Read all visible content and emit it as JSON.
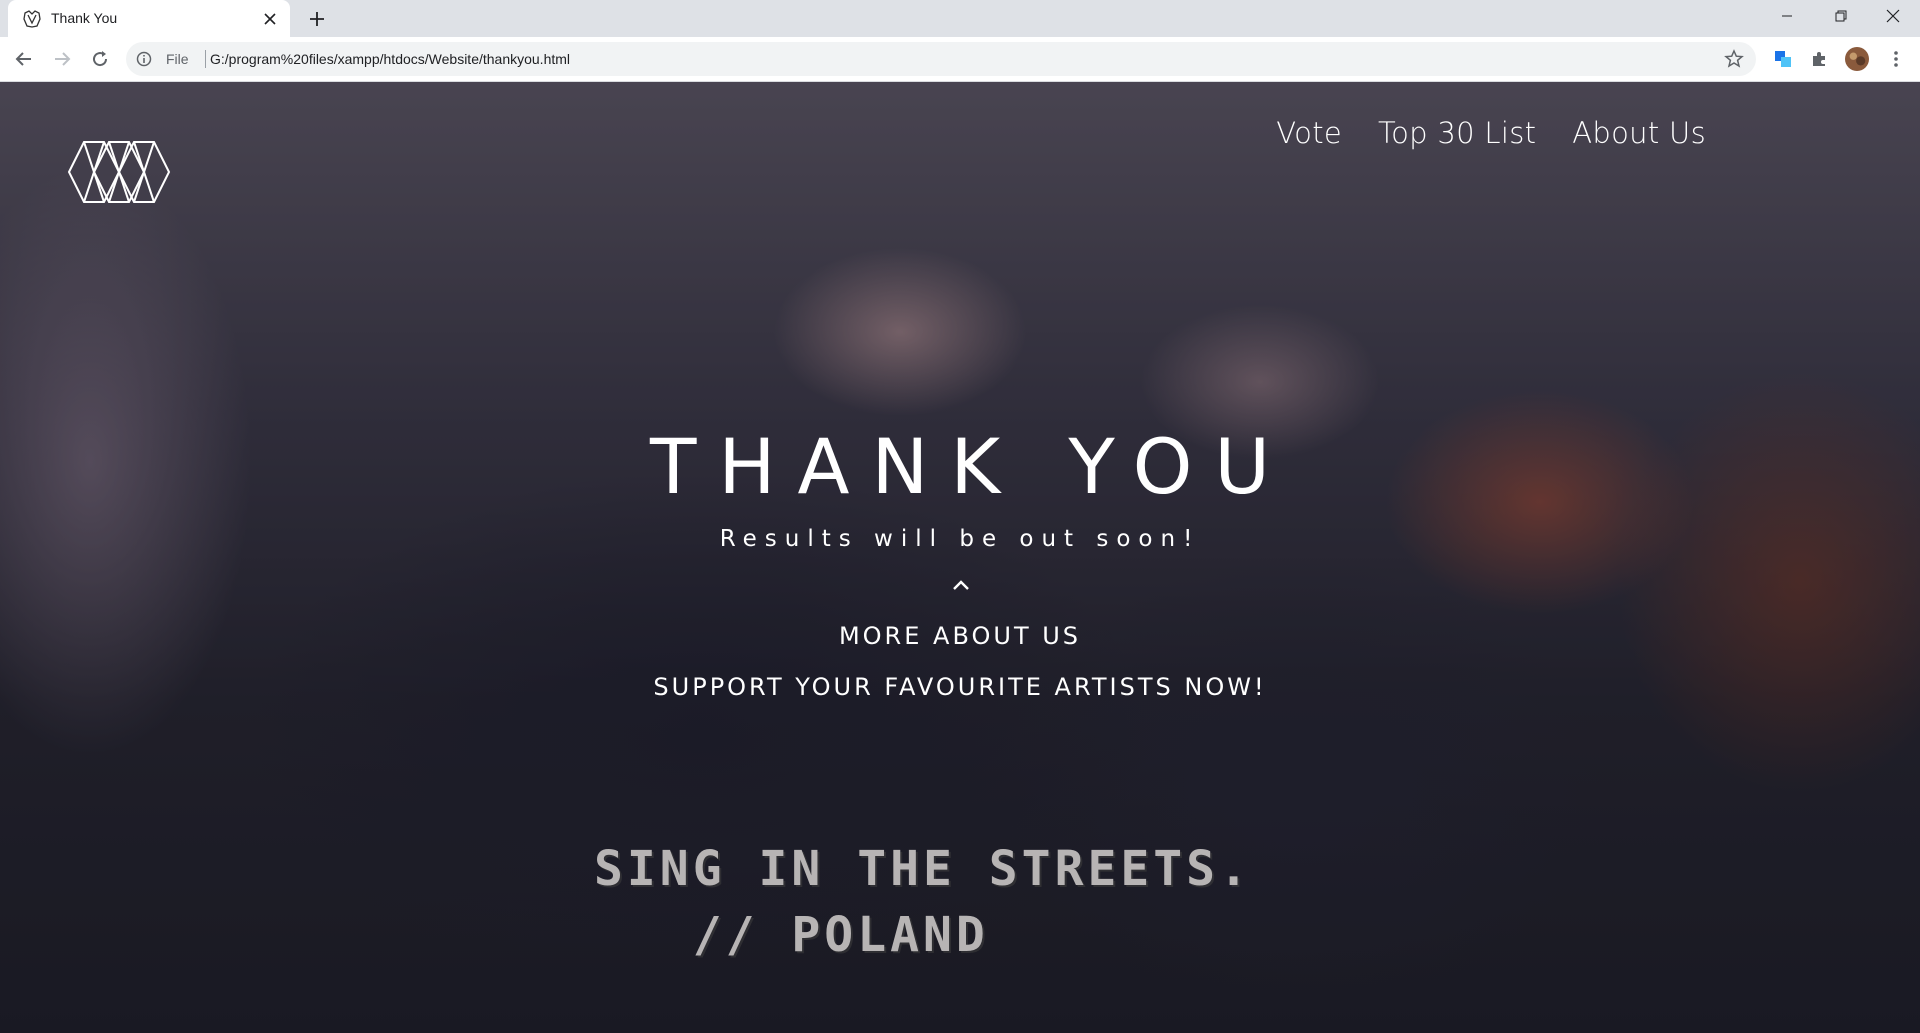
{
  "browser": {
    "tab": {
      "title": "Thank You"
    },
    "address": {
      "scheme": "File",
      "url": "G:/program%20files/xampp/htdocs/Website/thankyou.html"
    }
  },
  "page": {
    "nav": {
      "items": [
        "Vote",
        "Top 30 List",
        "About Us"
      ]
    },
    "hero": {
      "title": "THANK YOU",
      "subtitle": "Results will be out soon!",
      "link_about": "MORE ABOUT US",
      "link_support": "SUPPORT YOUR FAVOURITE ARTISTS NOW!"
    },
    "video_caption": {
      "line1": "SING IN THE STREETS.",
      "line2": "   // POLAND"
    }
  },
  "colors": {
    "hero_text": "#ffffff",
    "tabstrip": "#dee1e6",
    "caption": "#b7b4b4"
  }
}
